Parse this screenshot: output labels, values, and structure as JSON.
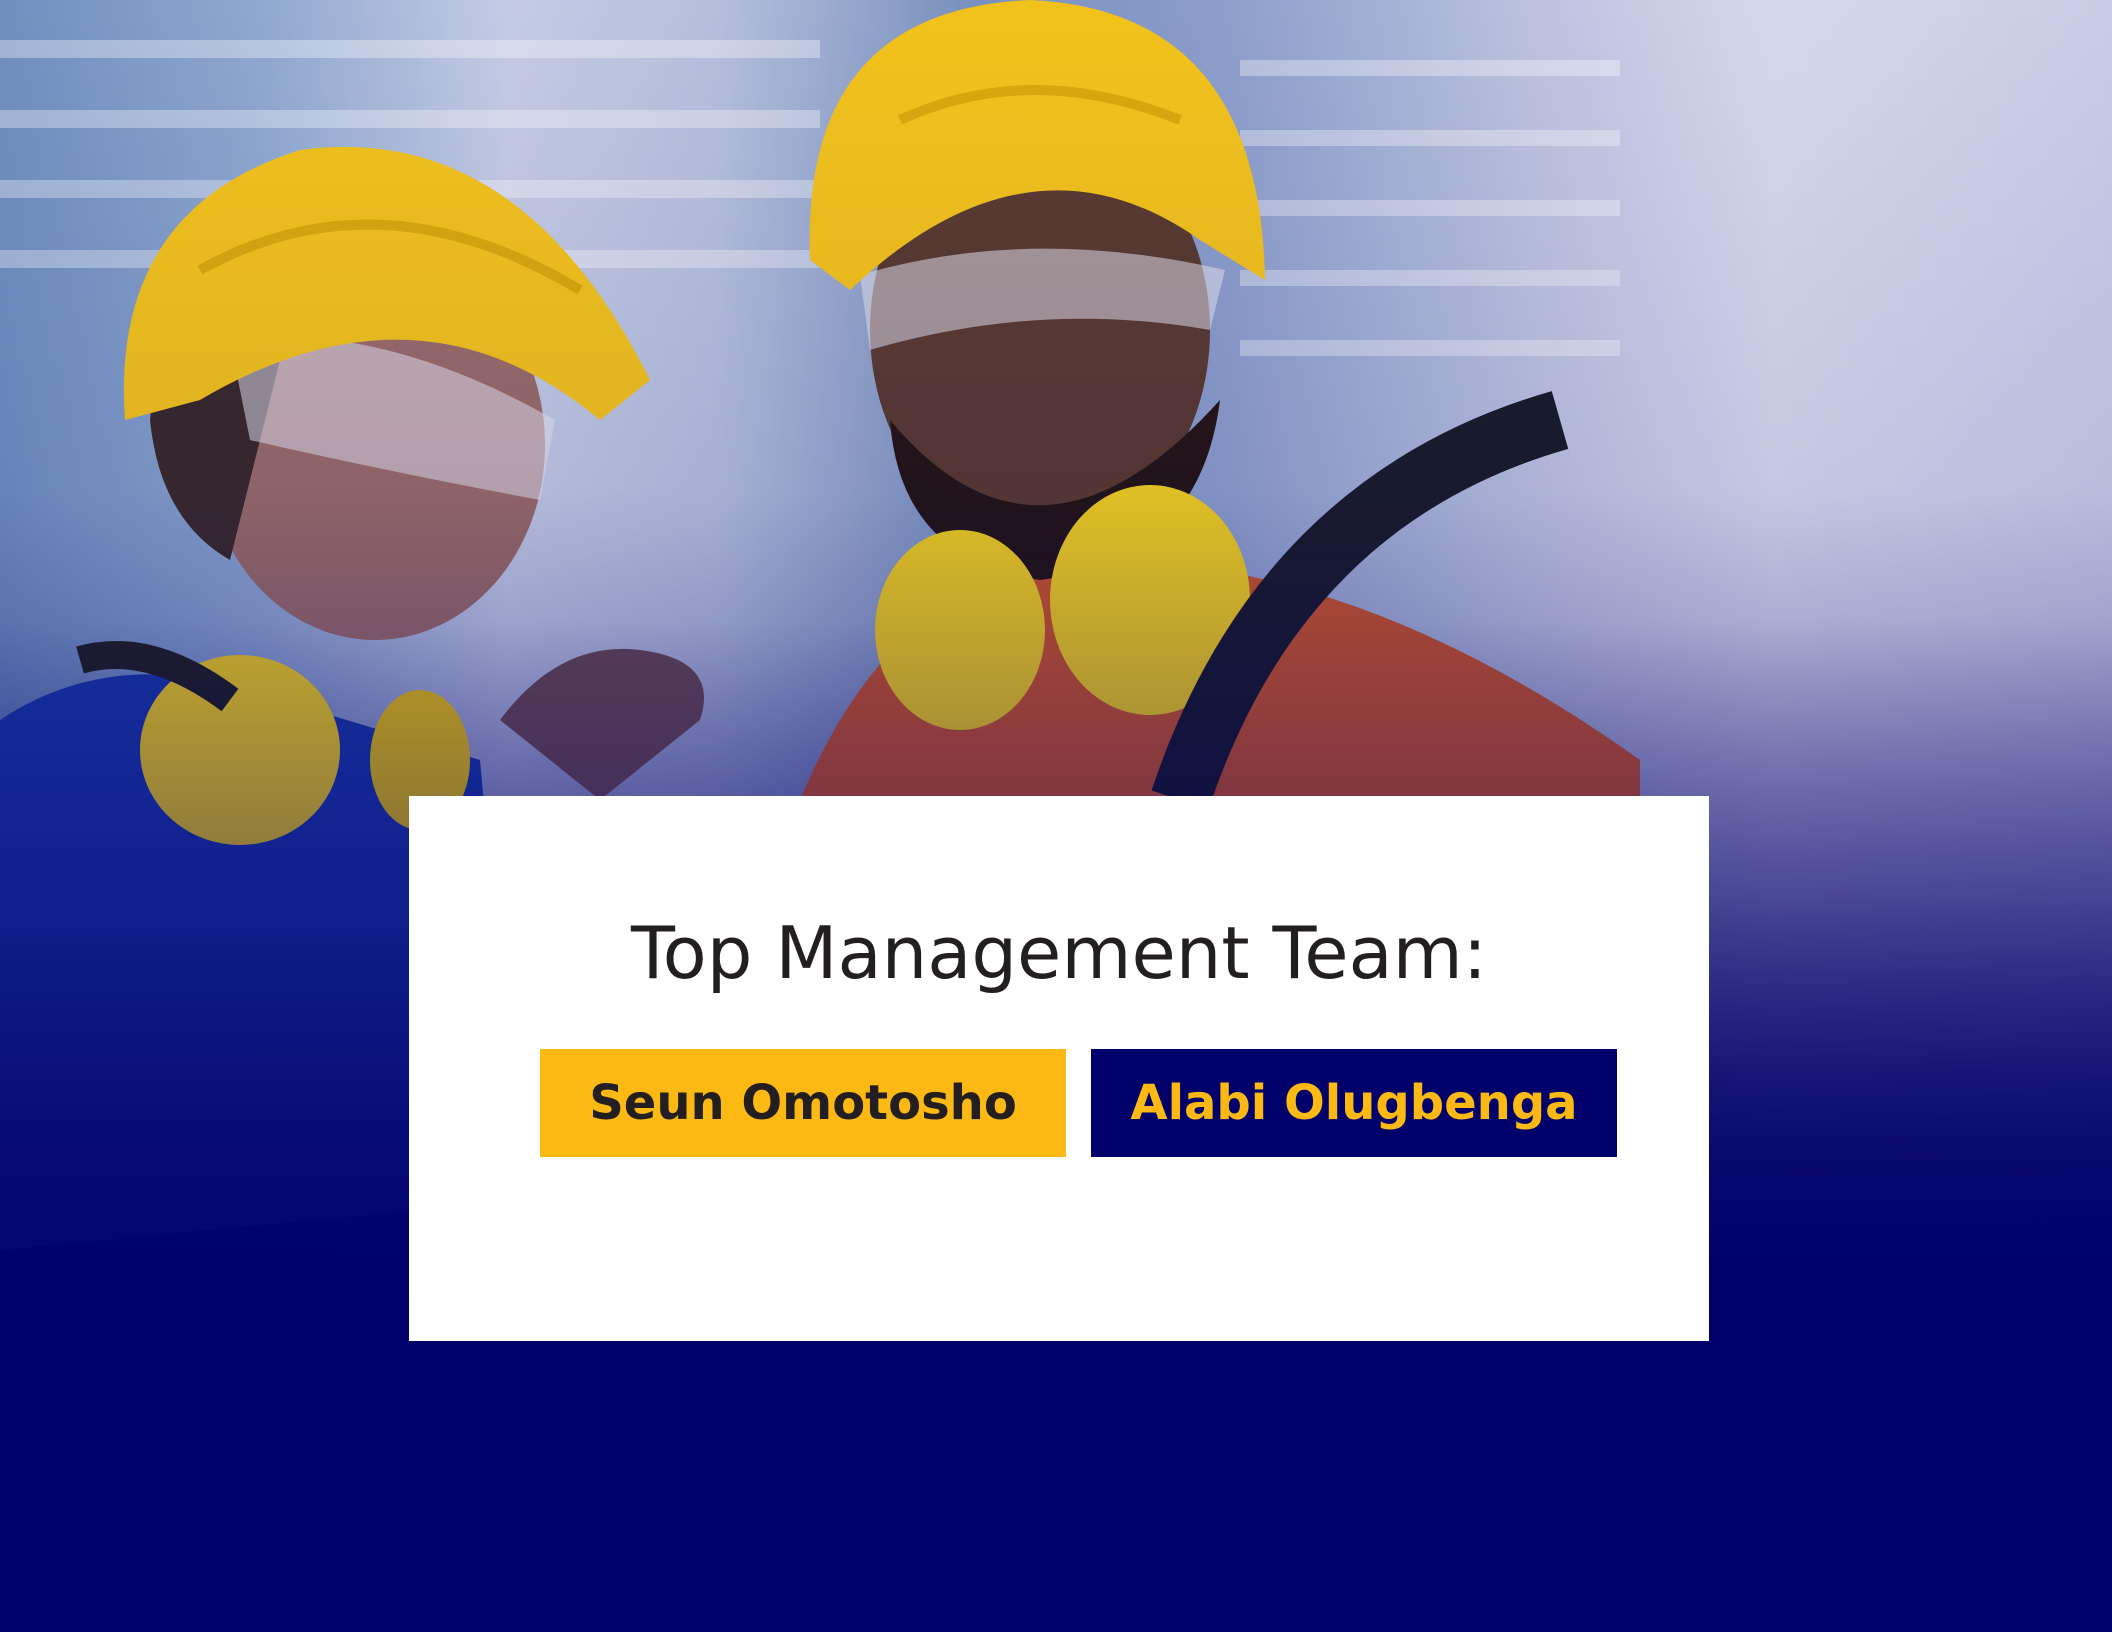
{
  "hero": {
    "icon": "workers-photo",
    "colors": {
      "brand_navy": "#01006a",
      "brand_yellow": "#fdb913"
    }
  },
  "card": {
    "title": "Top Management Team:",
    "members": [
      {
        "name": "Seun Omotosho"
      },
      {
        "name": "Alabi Olugbenga"
      }
    ]
  }
}
